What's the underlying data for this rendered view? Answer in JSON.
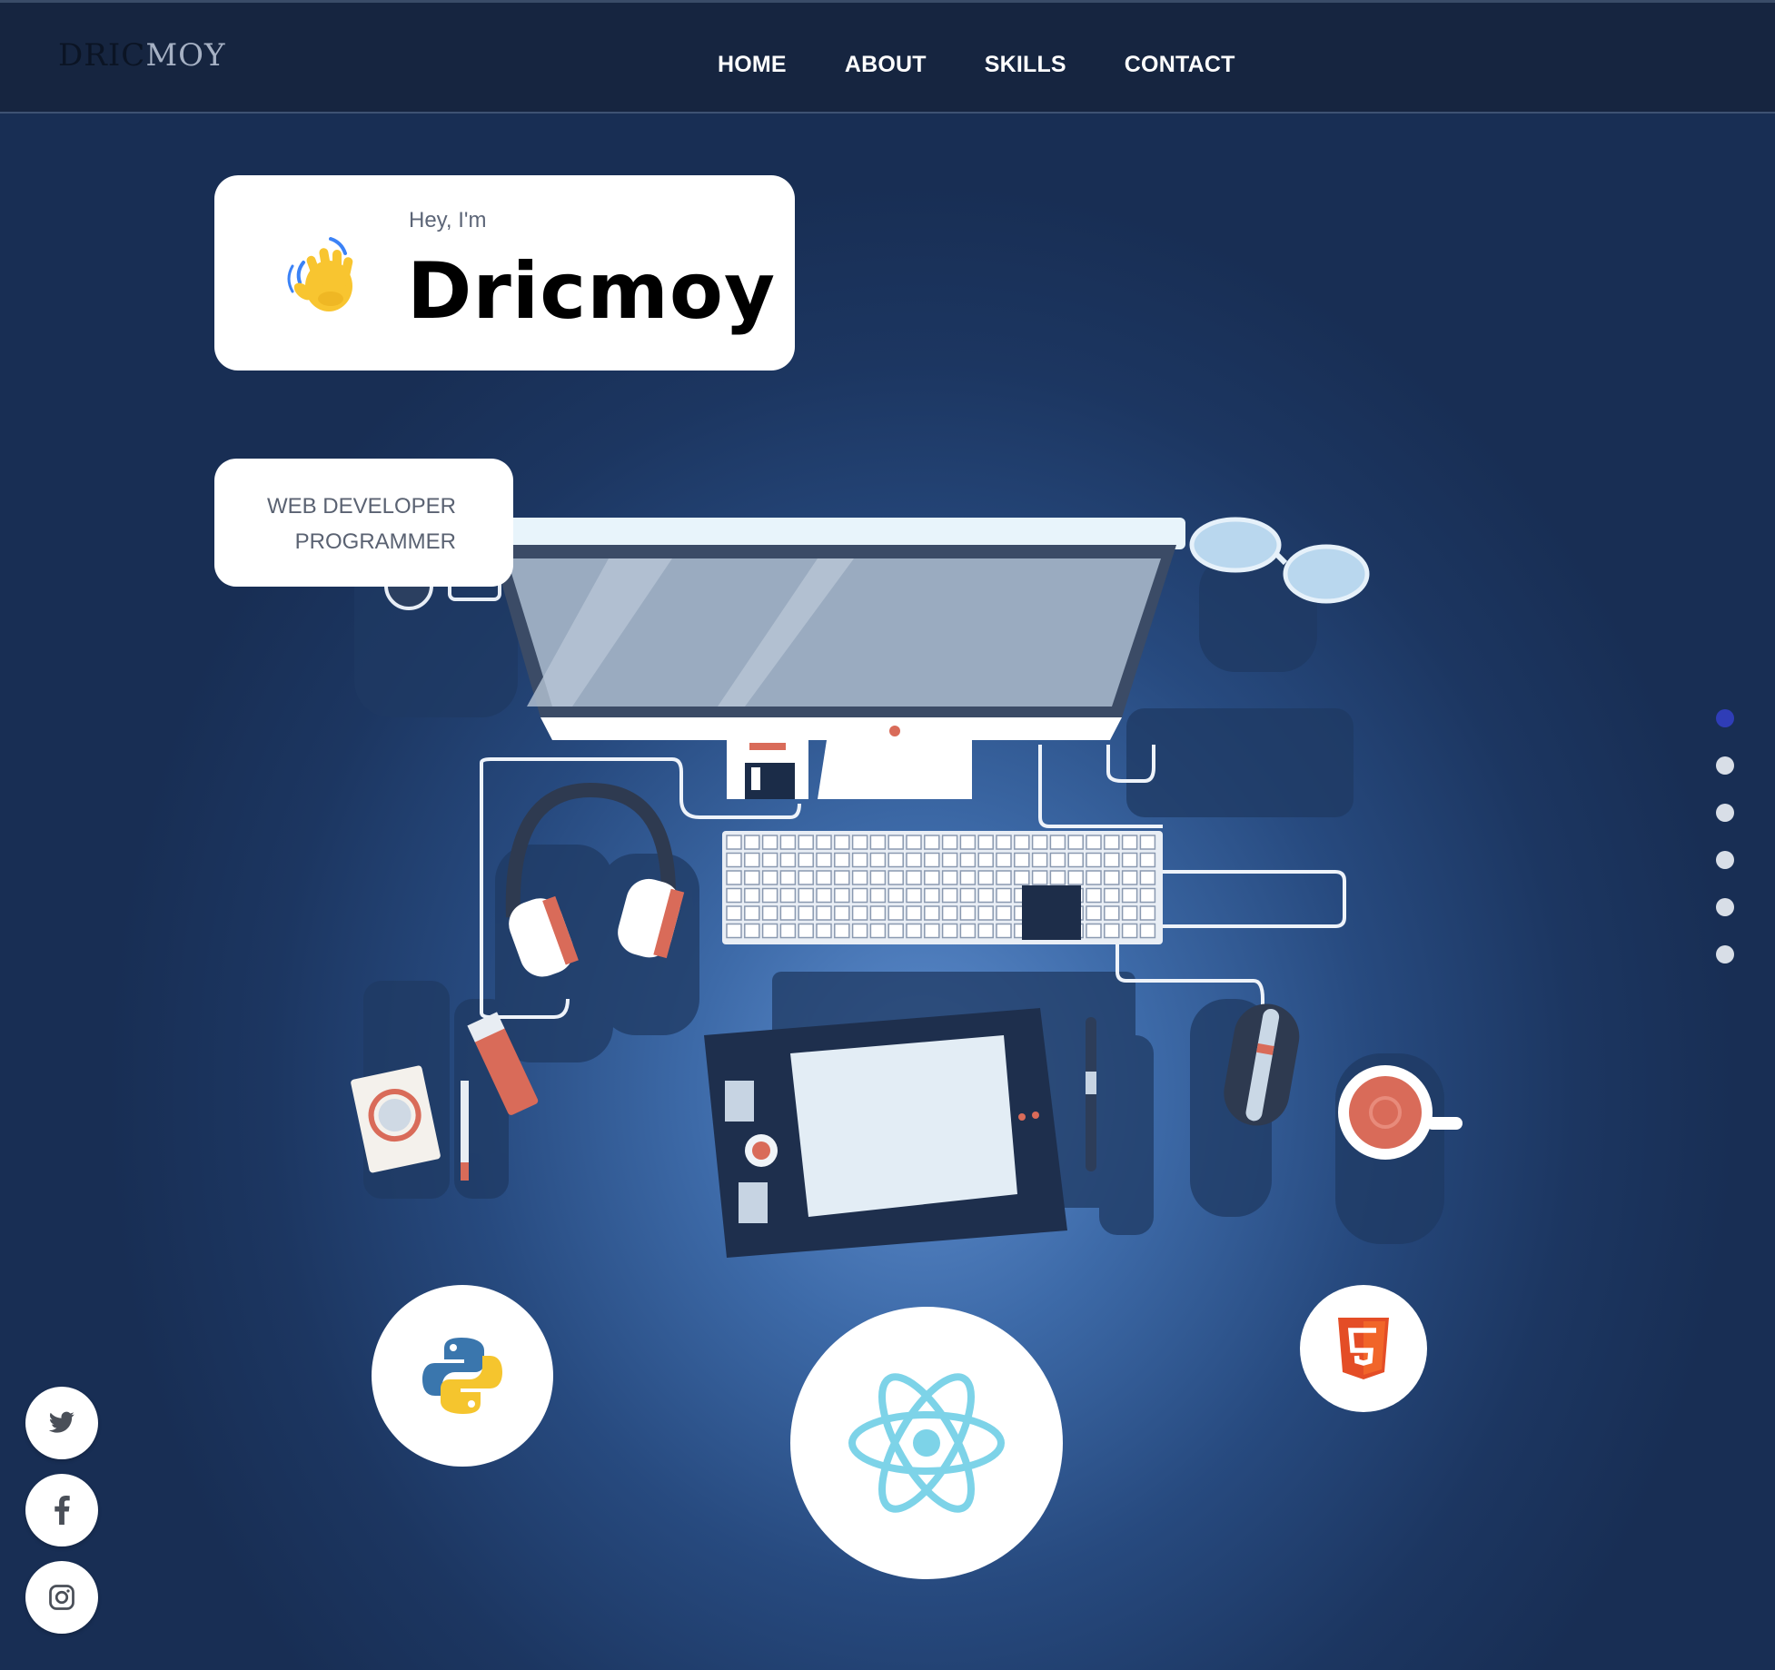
{
  "header": {
    "logo_part1": "DRIC",
    "logo_part2": "MOY",
    "nav": [
      "HOME",
      "ABOUT",
      "SKILLS",
      "CONTACT"
    ]
  },
  "hero": {
    "greeting": "Hey, I'm",
    "name": "Dricmoy",
    "wave_icon": "waving-hand-icon",
    "roles": [
      "WEB DEVELOPER",
      "PROGRAMMER"
    ]
  },
  "tech_icons": [
    "python-icon",
    "react-icon",
    "html5-icon"
  ],
  "section_dots": {
    "count": 6,
    "active_index": 0,
    "active_color": "#2f3db7"
  },
  "social": [
    "twitter-icon",
    "facebook-icon",
    "instagram-icon"
  ],
  "colors": {
    "nav_bg": "#162540",
    "page_bg": "#1c3661",
    "card_bg": "#ffffff"
  }
}
